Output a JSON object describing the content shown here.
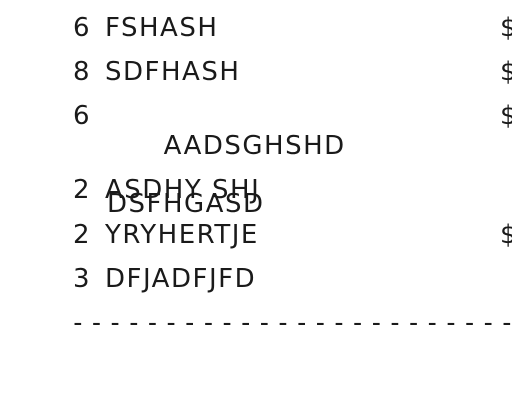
{
  "receipt": {
    "items": [
      {
        "qty": "6",
        "desc": "FSHASH",
        "desc2": "",
        "price": "$"
      },
      {
        "qty": "8",
        "desc": "SDFHASH",
        "desc2": "",
        "price": "$"
      },
      {
        "qty": "6",
        "desc": "AADSGHSHD",
        "desc2": "DSFHGASD",
        "price": "$"
      },
      {
        "qty": "2",
        "desc": "ASDHY SHJ",
        "desc2": "",
        "price": ""
      },
      {
        "qty": "2",
        "desc": "YRYHERTJE",
        "desc2": "",
        "price": "$"
      },
      {
        "qty": "3",
        "desc": "DFJADFJFD",
        "desc2": "",
        "price": ""
      }
    ],
    "divider": "------------------------------"
  }
}
